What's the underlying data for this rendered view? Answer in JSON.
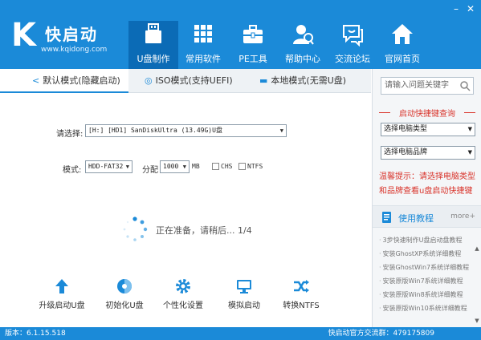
{
  "brand": {
    "name": "快启动",
    "url": "www.kqidong.com",
    "color": "#1b8ad8"
  },
  "nav": [
    {
      "label": "U盘制作",
      "icon": "usb-drive-icon",
      "active": true
    },
    {
      "label": "常用软件",
      "icon": "apps-grid-icon",
      "active": false
    },
    {
      "label": "PE工具",
      "icon": "toolbox-icon",
      "active": false
    },
    {
      "label": "帮助中心",
      "icon": "user-help-icon",
      "active": false
    },
    {
      "label": "交流论坛",
      "icon": "chat-icon",
      "active": false
    },
    {
      "label": "官网首页",
      "icon": "home-icon",
      "active": false
    }
  ],
  "tabs": [
    {
      "label": "默认模式(隐藏启动)",
      "icon": "share-icon"
    },
    {
      "label": "ISO模式(支持UEFI)",
      "icon": "disc-icon"
    },
    {
      "label": "本地模式(无需U盘)",
      "icon": "hdd-icon"
    }
  ],
  "form": {
    "select_label": "请选择:",
    "device": "[H:] [HD1] SanDiskUltra (13.49G)U盘",
    "mode_label": "模式:",
    "mode": "HDD-FAT32",
    "alloc_label": "分配",
    "alloc": "1000",
    "alloc_unit": "MB",
    "chs": "CHS",
    "ntfs": "NTFS"
  },
  "status": "正在准备，请稍后... 1/4",
  "tools": [
    {
      "label": "升级启动U盘",
      "icon": "upgrade-arrow-icon"
    },
    {
      "label": "初始化U盘",
      "icon": "format-disk-icon"
    },
    {
      "label": "个性化设置",
      "icon": "settings-gear-icon"
    },
    {
      "label": "模拟启动",
      "icon": "monitor-icon"
    },
    {
      "label": "转换NTFS",
      "icon": "convert-icon"
    }
  ],
  "right": {
    "search_placeholder": "请输入问题关键字",
    "quick_title": "启动快捷键查询",
    "computer_type": "选择电脑类型",
    "computer_brand": "选择电脑品牌",
    "tip_label": "温馨提示：",
    "tip_text": "请选择电脑类型和品牌查看u盘启动快捷键",
    "tutorial_title": "使用教程",
    "more": "more+",
    "tutorials": [
      "3步快速制作U盘启动盘教程",
      "安装GhostXP系统详细教程",
      "安装GhostWin7系统详细教程",
      "安装原版Win7系统详细教程",
      "安装原版Win8系统详细教程",
      "安装原版Win10系统详细教程"
    ]
  },
  "footer": {
    "version": "版本：6.1.15.518",
    "qq": "快启动官方交流群：479175809"
  }
}
